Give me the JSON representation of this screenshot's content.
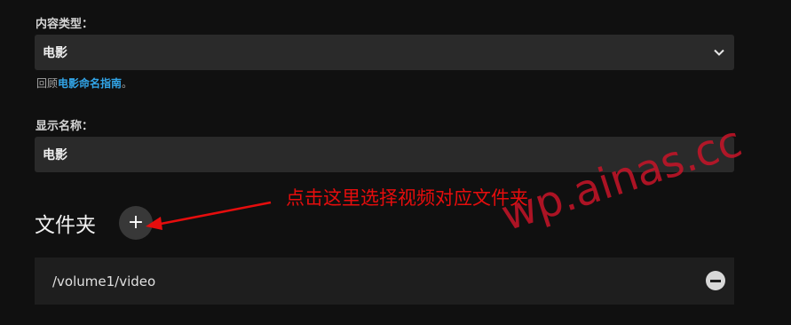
{
  "content_type": {
    "label": "内容类型：",
    "selected": "电影",
    "help_prefix": "回顾",
    "help_link": "电影命名指南",
    "help_suffix": "。"
  },
  "display_name": {
    "label": "显示名称：",
    "value": "电影"
  },
  "folders": {
    "title": "文件夹",
    "add_symbol": "+",
    "items": [
      {
        "path": "/volume1/video"
      }
    ]
  },
  "annotation": {
    "text": "点击这里选择视频对应文件夹",
    "color": "#e60d0d"
  },
  "watermark": {
    "text": "wp.ainas.cc"
  },
  "icons": {
    "select_chevron": "chevron-down-icon",
    "remove": "minus-circle-icon",
    "add": "plus-icon"
  }
}
